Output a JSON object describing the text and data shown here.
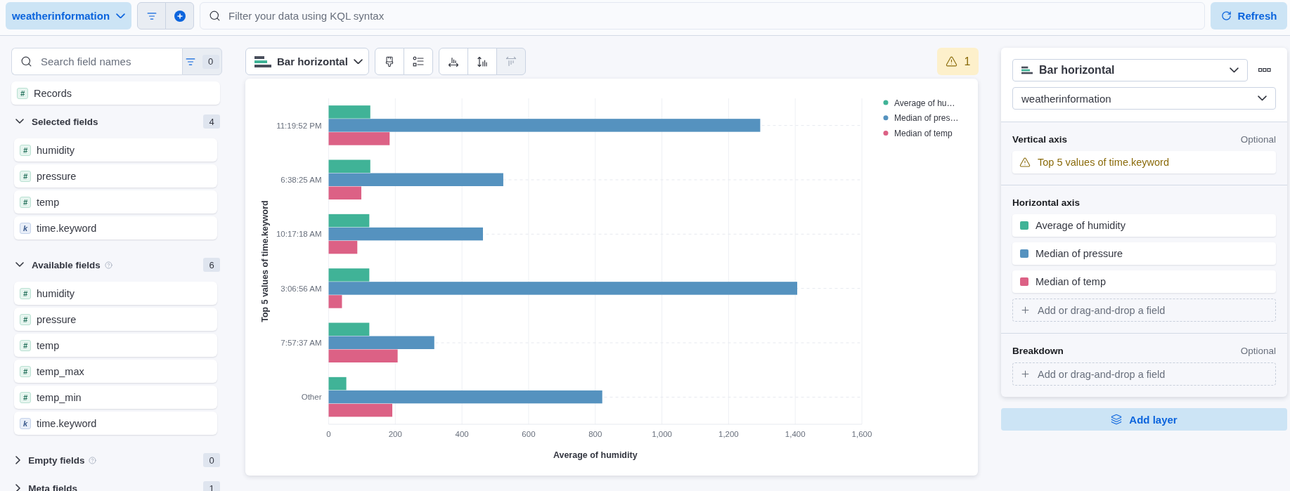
{
  "top_bar": {
    "data_view": "weatherinformation",
    "query": {
      "placeholder": "Filter your data using KQL syntax"
    },
    "refresh": "Refresh"
  },
  "field_list": {
    "search": {
      "placeholder": "Search field names"
    },
    "filter_count": "0",
    "records": {
      "name": "Records",
      "kind": "number",
      "token": "#"
    },
    "sections": [
      {
        "title": "Selected fields",
        "count": "4",
        "expanded": true,
        "help": false,
        "fields": [
          {
            "name": "humidity",
            "kind": "number",
            "token": "#"
          },
          {
            "name": "pressure",
            "kind": "number",
            "token": "#"
          },
          {
            "name": "temp",
            "kind": "number",
            "token": "#"
          },
          {
            "name": "time.keyword",
            "kind": "keyword",
            "token": "k"
          }
        ]
      },
      {
        "title": "Available fields",
        "count": "6",
        "expanded": true,
        "help": true,
        "fields": [
          {
            "name": "humidity",
            "kind": "number",
            "token": "#"
          },
          {
            "name": "pressure",
            "kind": "number",
            "token": "#"
          },
          {
            "name": "temp",
            "kind": "number",
            "token": "#"
          },
          {
            "name": "temp_max",
            "kind": "number",
            "token": "#"
          },
          {
            "name": "temp_min",
            "kind": "number",
            "token": "#"
          },
          {
            "name": "time.keyword",
            "kind": "keyword",
            "token": "k"
          }
        ]
      },
      {
        "title": "Empty fields",
        "count": "0",
        "expanded": false,
        "help": true
      },
      {
        "title": "Meta fields",
        "count": "1",
        "expanded": false,
        "help": false
      }
    ]
  },
  "workspace": {
    "chart_type": "Bar horizontal",
    "tool_groups": [
      {
        "tools": [
          {
            "kind": "appearance",
            "disabled": false
          },
          {
            "kind": "legend",
            "disabled": false
          }
        ]
      },
      {
        "tools": [
          {
            "kind": "bottom-axis",
            "disabled": false
          },
          {
            "kind": "left-axis",
            "disabled": false
          },
          {
            "kind": "top-axis",
            "disabled": true
          }
        ]
      }
    ],
    "warnings": "1",
    "chart": {
      "chart_data": {
        "type": "bar",
        "orientation": "horizontal",
        "xlabel": "Average of humidity",
        "ylabel": "Top 5 values of time.keyword",
        "categories": [
          "11:19:52 PM",
          "6:38:25 AM",
          "10:17:18 AM",
          "3:06:56 AM",
          "7:57:37 AM",
          "Other"
        ],
        "series": [
          {
            "name": "Average of hu…",
            "color": "#40b397",
            "values": [
              125,
              125,
              122,
              122,
              122,
              53
            ]
          },
          {
            "name": "Median of pres…",
            "color": "#5592bf",
            "values": [
              1295,
              524,
              463,
              1406,
              317,
              821
            ]
          },
          {
            "name": "Median of temp",
            "color": "#dc6185",
            "values": [
              183,
              98,
              86,
              40,
              207,
              191
            ]
          }
        ],
        "xlim": [
          0,
          1600
        ],
        "xticks": [
          0,
          200,
          400,
          600,
          800,
          {
            "value": 1000,
            "label": "1,000"
          },
          {
            "value": 1200,
            "label": "1,200"
          },
          {
            "value": 1400,
            "label": "1,400"
          },
          {
            "value": 1600,
            "label": "1,600"
          }
        ],
        "grid": true,
        "legend": true
      }
    }
  },
  "config_panel": {
    "chart_type": "Bar horizontal",
    "data_view": "weatherinformation",
    "groups": [
      {
        "title": "Vertical axis",
        "optional": "Optional",
        "items": [
          {
            "kind": "warning",
            "label": "Top 5 values of time.keyword"
          }
        ]
      },
      {
        "title": "Horizontal axis",
        "items": [
          {
            "kind": "metric",
            "label": "Average of humidity",
            "color": "#40b397"
          },
          {
            "kind": "metric",
            "label": "Median of pressure",
            "color": "#5592bf"
          },
          {
            "kind": "metric",
            "label": "Median of temp",
            "color": "#dc6185"
          }
        ],
        "add_field": "Add or drag-and-drop a field"
      },
      {
        "title": "Breakdown",
        "optional": "Optional",
        "add_field": "Add or drag-and-drop a field"
      }
    ],
    "add_layer": "Add layer"
  }
}
